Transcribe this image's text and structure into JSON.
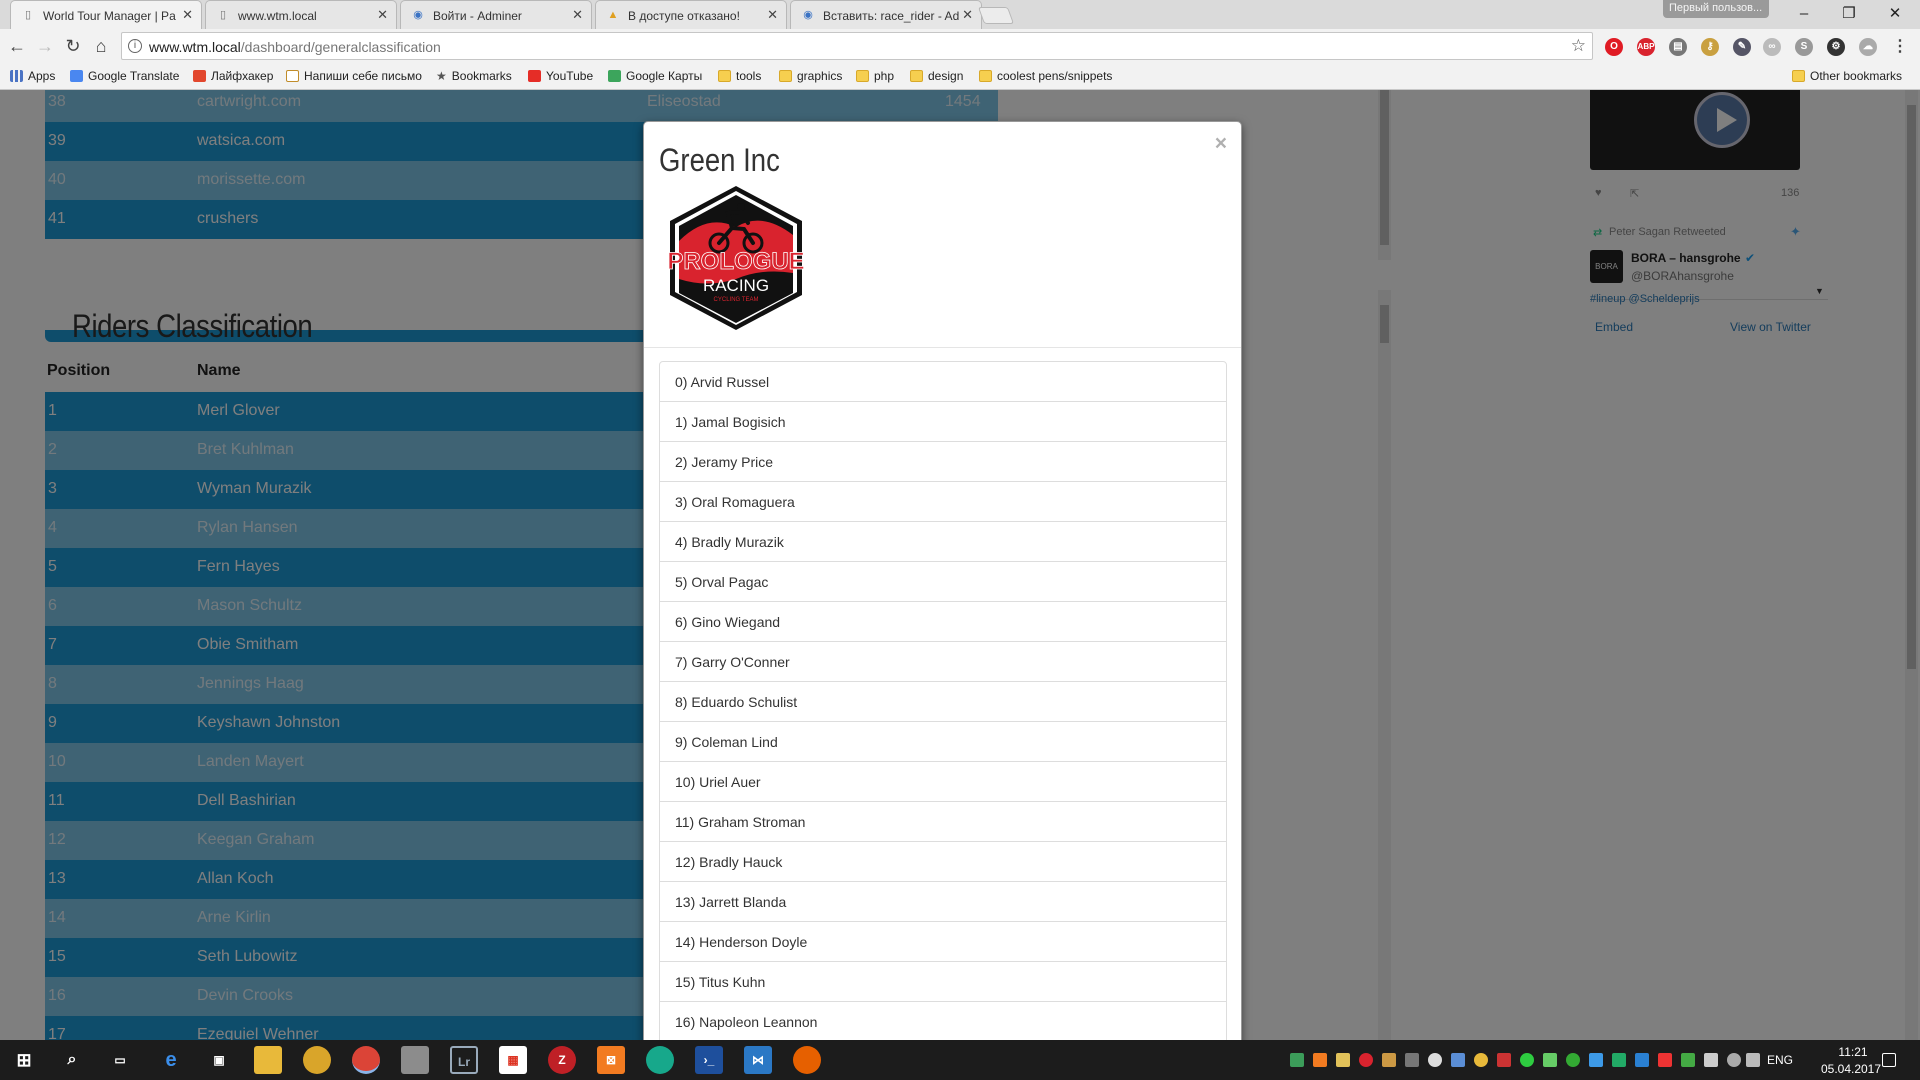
{
  "browser": {
    "tabs": [
      {
        "title": "World Tour Manager | Pa",
        "icon": "page-icon",
        "active": true
      },
      {
        "title": "www.wtm.local",
        "icon": "page-icon",
        "active": false
      },
      {
        "title": "Войти - Adminer",
        "icon": "adminer-icon",
        "active": false
      },
      {
        "title": "В доступе отказано!",
        "icon": "warning-icon",
        "active": false
      },
      {
        "title": "Вставить: race_rider - Ad",
        "icon": "adminer-icon",
        "active": false
      }
    ],
    "profile_label": "Первый пользов...",
    "url_host": "www.wtm.local",
    "url_path": "/dashboard/generalclassification",
    "bookmarks": [
      {
        "label": "Apps",
        "icon": "apps-grid-icon"
      },
      {
        "label": "Google Translate",
        "icon": "translate-icon"
      },
      {
        "label": "Лайфхакер",
        "icon": "lifehacker-icon"
      },
      {
        "label": "Напиши себе письмо",
        "icon": "mail-icon"
      },
      {
        "label": "Bookmarks",
        "icon": "star-icon"
      },
      {
        "label": "YouTube",
        "icon": "youtube-icon"
      },
      {
        "label": "Google Карты",
        "icon": "maps-icon"
      },
      {
        "label": "tools",
        "icon": "folder-icon"
      },
      {
        "label": "graphics",
        "icon": "folder-icon"
      },
      {
        "label": "php",
        "icon": "folder-icon"
      },
      {
        "label": "design",
        "icon": "folder-icon"
      },
      {
        "label": "coolest pens/snippets",
        "icon": "folder-icon"
      }
    ],
    "other_bookmarks": "Other bookmarks"
  },
  "top_table": {
    "rows": [
      {
        "pos": "38",
        "name": "cartwright.com",
        "c3": "Eliseostad",
        "c4": "1454"
      },
      {
        "pos": "39",
        "name": "watsica.com",
        "c3": "",
        "c4": ""
      },
      {
        "pos": "40",
        "name": "morissette.com",
        "c3": "",
        "c4": ""
      },
      {
        "pos": "41",
        "name": "crushers",
        "c3": "",
        "c4": ""
      }
    ]
  },
  "riders_classification": {
    "heading": "Riders Classification",
    "columns": {
      "position": "Position",
      "name": "Name"
    },
    "rows": [
      {
        "pos": "1",
        "name": "Merl Glover"
      },
      {
        "pos": "2",
        "name": "Bret Kuhlman"
      },
      {
        "pos": "3",
        "name": "Wyman Murazik"
      },
      {
        "pos": "4",
        "name": "Rylan Hansen"
      },
      {
        "pos": "5",
        "name": "Fern Hayes"
      },
      {
        "pos": "6",
        "name": "Mason Schultz"
      },
      {
        "pos": "7",
        "name": "Obie Smitham"
      },
      {
        "pos": "8",
        "name": "Jennings Haag"
      },
      {
        "pos": "9",
        "name": "Keyshawn Johnston"
      },
      {
        "pos": "10",
        "name": "Landen Mayert"
      },
      {
        "pos": "11",
        "name": "Dell Bashirian"
      },
      {
        "pos": "12",
        "name": "Keegan Graham"
      },
      {
        "pos": "13",
        "name": "Allan Koch"
      },
      {
        "pos": "14",
        "name": "Arne Kirlin"
      },
      {
        "pos": "15",
        "name": "Seth Lubowitz"
      },
      {
        "pos": "16",
        "name": "Devin Crooks"
      },
      {
        "pos": "17",
        "name": "Ezequiel Wehner"
      }
    ]
  },
  "twitter": {
    "retweet_label": "Peter Sagan Retweeted",
    "name": "BORA – hansgrohe",
    "handle": "@BORAhansgrohe",
    "avatar_text": "BORA",
    "hashtag_line": "#lineup @Scheldeprijs",
    "count": "136",
    "embed": "Embed",
    "view_on": "View on Twitter"
  },
  "modal": {
    "title": "Green Inc",
    "close": "×",
    "logo_text": {
      "line1": "PROLOGUE",
      "line2": "RACING",
      "line3": "CYCLING TEAM"
    },
    "riders": [
      "0) Arvid Russel",
      "1) Jamal Bogisich",
      "2) Jeramy Price",
      "3) Oral Romaguera",
      "4) Bradly Murazik",
      "5) Orval Pagac",
      "6) Gino Wiegand",
      "7) Garry O'Conner",
      "8) Eduardo Schulist",
      "9) Coleman Lind",
      "10) Uriel Auer",
      "11) Graham Stroman",
      "12) Bradly Hauck",
      "13) Jarrett Blanda",
      "14) Henderson Doyle",
      "15) Titus Kuhn",
      "16) Napoleon Leannon"
    ]
  },
  "taskbar": {
    "lang": "ENG",
    "time": "11:21",
    "date": "05.04.2017"
  },
  "colors": {
    "row_dark": "#1d9ad6",
    "row_light": "#7fc7e9",
    "logo_red": "#d9232e"
  }
}
